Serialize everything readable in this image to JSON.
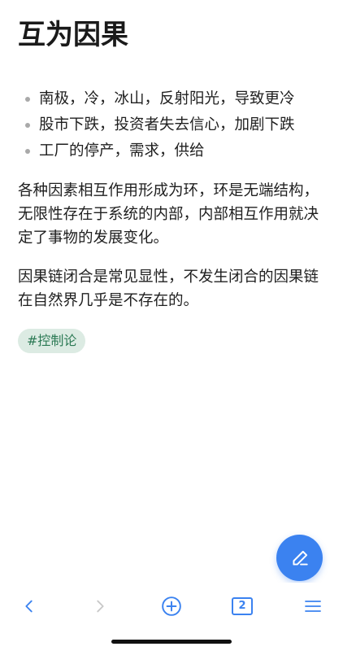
{
  "note": {
    "title": "互为因果",
    "bullets": [
      "南极，冷，冰山，反射阳光，导致更冷",
      "股市下跌，投资者失去信心，加剧下跌",
      "工厂的停产，需求，供给"
    ],
    "paragraphs": [
      "各种因素相互作用形成为环，环是无端结构，无限性存在于系统的内部，内部相互作用就决定了事物的发展变化。",
      "因果链闭合是常见显性，不发生闭合的因果链在自然界几乎是不存在的。"
    ],
    "tag": "#控制论"
  },
  "fab": {
    "icon": "pencil-icon"
  },
  "toolbar": {
    "back_icon": "chevron-left-icon",
    "forward_icon": "chevron-right-icon",
    "new_icon": "plus-circle-icon",
    "tab_count": "2",
    "menu_icon": "menu-icon"
  },
  "colors": {
    "accent": "#3b82f0",
    "tag_bg": "#dcebe3",
    "tag_text": "#2c7a55",
    "disabled": "#c8c8c8"
  }
}
